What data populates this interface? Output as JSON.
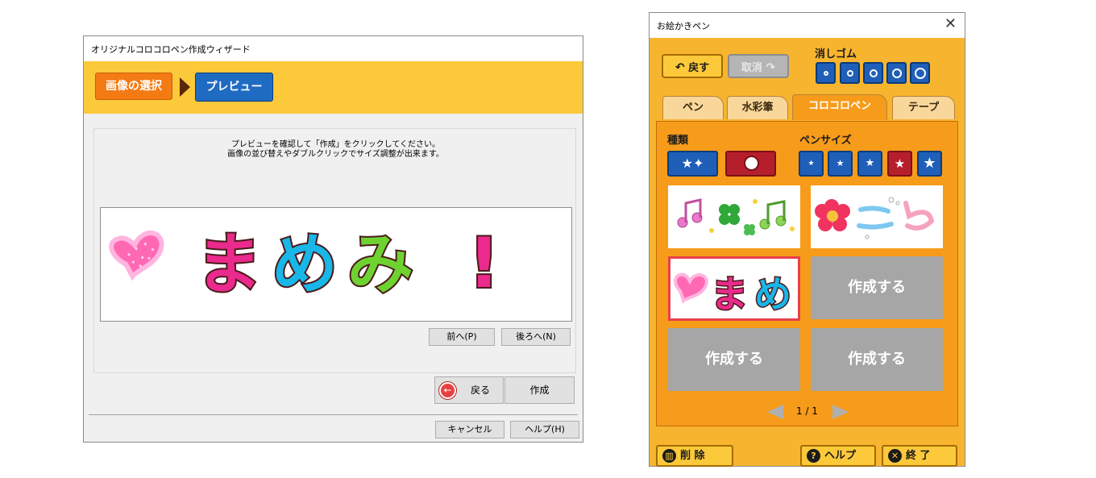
{
  "wizard": {
    "title": "オリジナルコロコロペン作成ウィザード",
    "steps": {
      "select_label": "画像の選択",
      "preview_label": "プレビュー"
    },
    "instruction_line1": "プレビューを確認して「作成」をクリックしてください。",
    "instruction_line2": "画像の並び替えやダブルクリックでサイズ調整が出来ます。",
    "preview_chars": [
      "ま",
      "め",
      "み",
      "!"
    ],
    "prev_button": "前へ(P)",
    "next_button": "後ろへ(N)",
    "back_button": "戻る",
    "create_button": "作成",
    "cancel_button": "キャンセル",
    "help_button": "ヘルプ(H)"
  },
  "oekaki": {
    "title": "お絵かきペン",
    "close_glyph": "✕",
    "undo_label": "戻す",
    "redo_label": "取消",
    "eraser_label": "消しゴム",
    "tabs": [
      "ペン",
      "水彩筆",
      "コロコロペン",
      "テープ"
    ],
    "active_tab": "コロコロペン",
    "kind_label": "種類",
    "pen_size_label": "ペンサイズ",
    "cells": [
      {
        "type": "image",
        "content": "music-clover"
      },
      {
        "type": "image",
        "content": "flower-kotoba"
      },
      {
        "type": "image",
        "content": "mame-custom",
        "chars": [
          "ま",
          "め"
        ],
        "selected": true
      },
      {
        "type": "empty",
        "label": "作成する"
      },
      {
        "type": "empty",
        "label": "作成する"
      },
      {
        "type": "empty",
        "label": "作成する"
      }
    ],
    "page_indicator": "1 / 1",
    "delete_button": "削 除",
    "help_button": "ヘルプ",
    "exit_button": "終 了",
    "colors": {
      "panel_orange": "#f79b1a",
      "blue_button": "#1f5fb8",
      "red_button": "#b51f2b",
      "selection": "#e8404b"
    }
  }
}
